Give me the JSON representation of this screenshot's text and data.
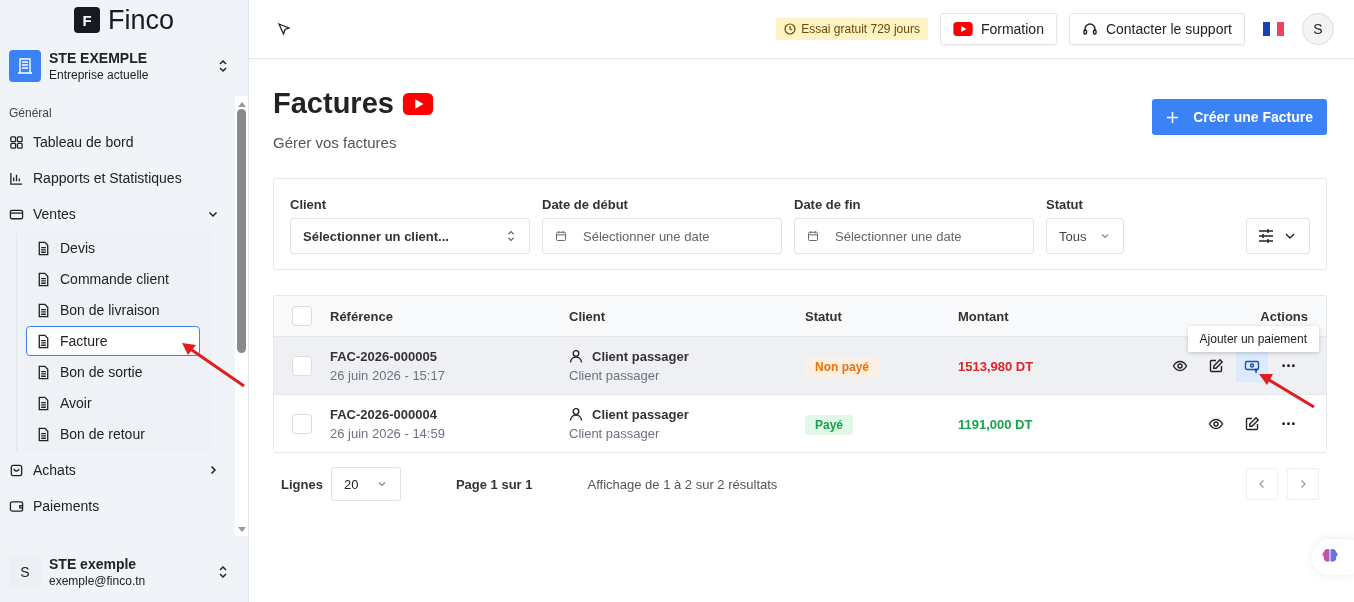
{
  "brand": {
    "mark": "F",
    "name": "Finco"
  },
  "company": {
    "name": "STE EXEMPLE",
    "subtitle": "Entreprise actuelle"
  },
  "nav": {
    "section": "Général",
    "items": [
      {
        "label": "Tableau de bord",
        "kind": "grid"
      },
      {
        "label": "Rapports et Statistiques",
        "kind": "chart"
      },
      {
        "label": "Ventes",
        "kind": "card",
        "expanded": true,
        "children": [
          {
            "label": "Devis",
            "selected": false
          },
          {
            "label": "Commande client",
            "selected": false
          },
          {
            "label": "Bon de livraison",
            "selected": false
          },
          {
            "label": "Facture",
            "selected": true
          },
          {
            "label": "Bon de sortie",
            "selected": false
          },
          {
            "label": "Avoir",
            "selected": false
          },
          {
            "label": "Bon de retour",
            "selected": false
          }
        ]
      },
      {
        "label": "Achats",
        "kind": "bag",
        "expanded": false
      },
      {
        "label": "Paiements",
        "kind": "wallet"
      }
    ]
  },
  "user": {
    "initial": "S",
    "name": "STE exemple",
    "email": "exemple@finco.tn"
  },
  "header": {
    "trial": "Essai gratuit 729 jours",
    "training": "Formation",
    "support": "Contacter le support",
    "avatar": "S"
  },
  "page": {
    "title": "Factures",
    "subtitle": "Gérer vos factures",
    "create_button": "Créer une Facture"
  },
  "filters": [
    {
      "label": "Client",
      "kind": "select",
      "placeholder": "Sélectionner un client..."
    },
    {
      "label": "Date de début",
      "kind": "date",
      "placeholder": "Sélectionner une date"
    },
    {
      "label": "Date de fin",
      "kind": "date",
      "placeholder": "Sélectionner une date"
    },
    {
      "label": "Statut",
      "kind": "status",
      "value": "Tous"
    }
  ],
  "table": {
    "select_all_checked": false,
    "columns": [
      "Référence",
      "Client",
      "Statut",
      "Montant",
      "Actions"
    ],
    "rows": [
      {
        "reference": "FAC-2026-000005",
        "date": "26 juin 2026 - 15:17",
        "client": "Client passager",
        "client_sub": "Client passager",
        "status": "Non payé",
        "kind": "unpaid",
        "amount": "1513,980 DT",
        "hovered": true,
        "checked": false,
        "actions": [
          {
            "kind": "view",
            "highlighted": false
          },
          {
            "kind": "edit",
            "highlighted": false
          },
          {
            "kind": "payment",
            "highlighted": true
          },
          {
            "kind": "more",
            "highlighted": false
          }
        ]
      },
      {
        "reference": "FAC-2026-000004",
        "date": "26 juin 2026 - 14:59",
        "client": "Client passager",
        "client_sub": "Client passager",
        "status": "Payé",
        "kind": "paid",
        "amount": "1191,000 DT",
        "hovered": false,
        "checked": false,
        "actions": [
          {
            "kind": "view",
            "highlighted": false
          },
          {
            "kind": "edit",
            "highlighted": false
          },
          {
            "kind": "more",
            "highlighted": false
          }
        ]
      }
    ]
  },
  "tooltip": {
    "text": "Ajouter un paiement"
  },
  "pagination": {
    "rows_label": "Lignes",
    "rows_value": "20",
    "page": "Page 1 sur 1",
    "summary": "Affichage de 1 à 2 sur 2 résultats"
  }
}
